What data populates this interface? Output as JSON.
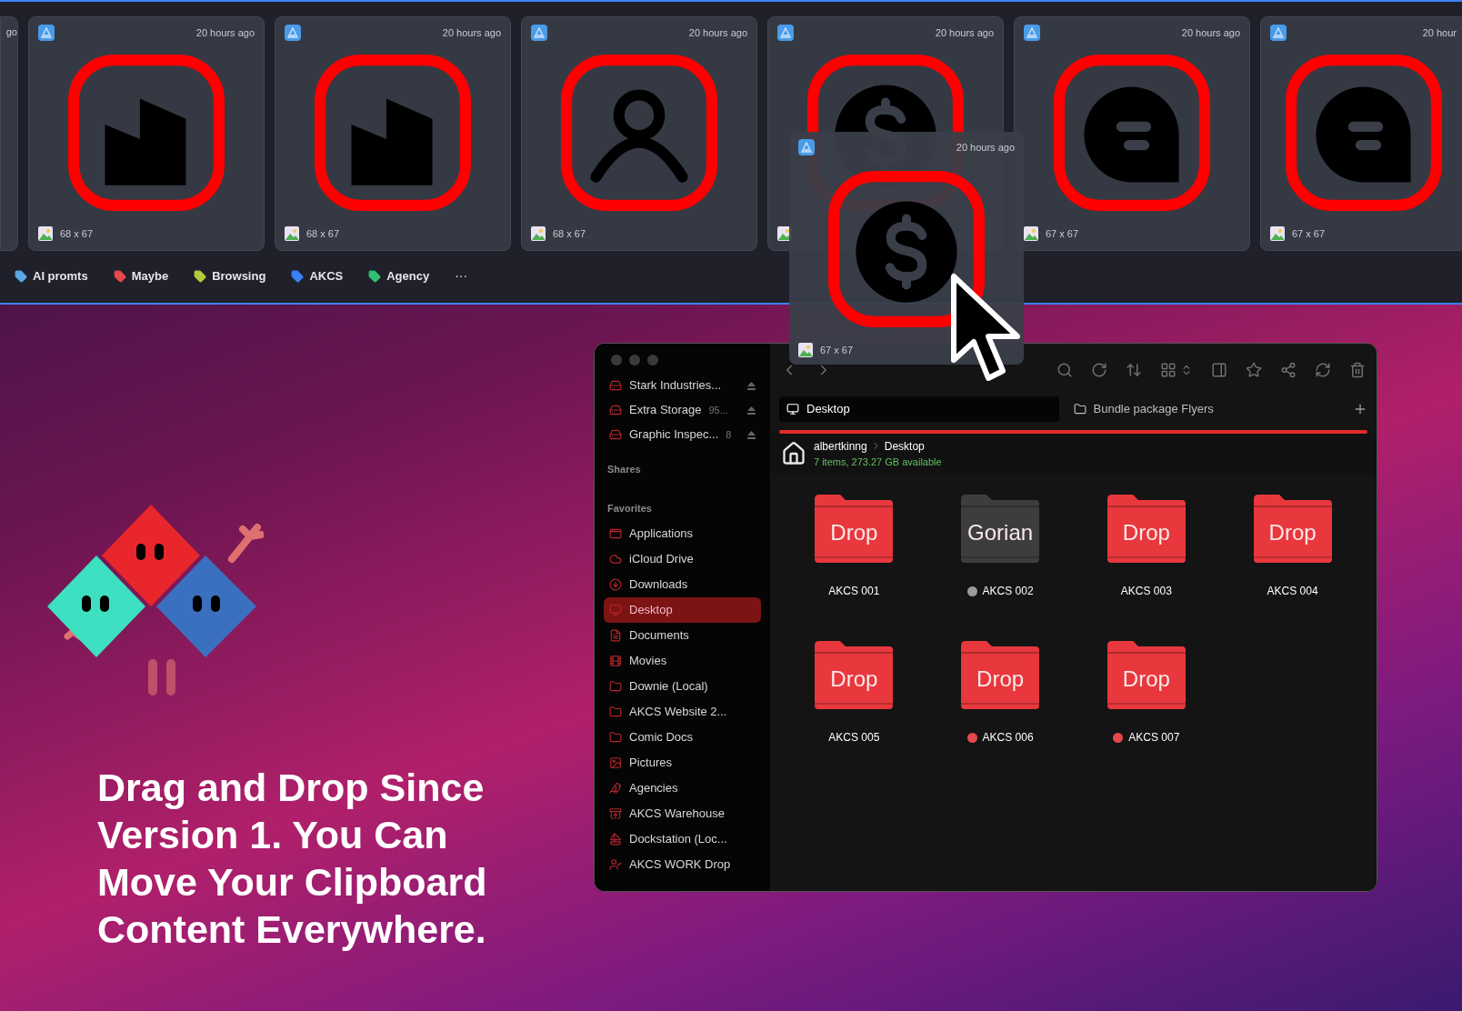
{
  "clipboard": {
    "partial_card": {
      "time": "go"
    },
    "cards": [
      {
        "time": "20 hours ago",
        "size": "68 x 67",
        "kind": "factory"
      },
      {
        "time": "20 hours ago",
        "size": "68 x 67",
        "kind": "factory"
      },
      {
        "time": "20 hours ago",
        "size": "68 x 67",
        "kind": "person"
      },
      {
        "time": "20 hours ago",
        "kind": "dollar"
      },
      {
        "time": "20 hours ago",
        "size": "67 x 67",
        "kind": "chat"
      },
      {
        "time": "20 hour",
        "size": "67 x 67",
        "kind": "chat"
      }
    ],
    "tags": [
      {
        "label": "AI promts",
        "color": "#5aa9e6"
      },
      {
        "label": "Maybe",
        "color": "#e5484d"
      },
      {
        "label": "Browsing",
        "color": "#b5c93a"
      },
      {
        "label": "AKCS",
        "color": "#3b82f6"
      },
      {
        "label": "Agency",
        "color": "#2fbf71"
      }
    ],
    "more": "···",
    "dragged_card": {
      "time": "20 hours ago",
      "size": "67 x 67",
      "kind": "dollar"
    }
  },
  "finder": {
    "devices": [
      {
        "name": "Stark Industries..."
      },
      {
        "name": "Extra Storage",
        "detail": "95..."
      },
      {
        "name": "Graphic Inspec...",
        "detail": "8"
      }
    ],
    "sections": [
      {
        "title": "Shares"
      },
      {
        "title": "Favorites",
        "items": [
          {
            "name": "Applications",
            "kind": "apps",
            "selected": false
          },
          {
            "name": "iCloud Drive",
            "kind": "cloud",
            "selected": false
          },
          {
            "name": "Downloads",
            "kind": "download",
            "selected": false
          },
          {
            "name": "Desktop",
            "kind": "desktop",
            "selected": true
          },
          {
            "name": "Documents",
            "kind": "doc",
            "selected": false
          },
          {
            "name": "Movies",
            "kind": "film",
            "selected": false
          },
          {
            "name": "Downie (Local)",
            "kind": "folder",
            "selected": false
          },
          {
            "name": "AKCS Website 2...",
            "kind": "folder",
            "selected": false
          },
          {
            "name": "Comic Docs",
            "kind": "folder",
            "selected": false
          },
          {
            "name": "Pictures",
            "kind": "image",
            "selected": false
          },
          {
            "name": "Agencies",
            "kind": "agent",
            "selected": false
          },
          {
            "name": "AKCS Warehouse",
            "kind": "box",
            "selected": false
          },
          {
            "name": "Dockstation (Loc...",
            "kind": "boat",
            "selected": false
          },
          {
            "name": "AKCS WORK Drop",
            "kind": "user",
            "selected": false
          }
        ]
      }
    ],
    "tabs": [
      {
        "label": "Desktop",
        "selected": true
      },
      {
        "label": "Bundle package Flyers",
        "selected": false
      }
    ],
    "path": [
      "albertkinng",
      "Desktop"
    ],
    "status": "7 items, 273.27 GB available",
    "files": [
      {
        "name": "AKCS 001",
        "folder_label": "Drop",
        "kind": "red"
      },
      {
        "name": "AKCS 002",
        "folder_label": "Gorian",
        "kind": "dark",
        "color": "#9a9a9a"
      },
      {
        "name": "AKCS 003",
        "folder_label": "Drop",
        "kind": "red"
      },
      {
        "name": "AKCS 004",
        "folder_label": "Drop",
        "kind": "red"
      },
      {
        "name": "AKCS 005",
        "folder_label": "Drop",
        "kind": "red"
      },
      {
        "name": "AKCS 006",
        "folder_label": "Drop",
        "kind": "red",
        "color": "#e5484d"
      },
      {
        "name": "AKCS 007",
        "folder_label": "Drop",
        "kind": "red",
        "color": "#e5484d"
      }
    ]
  },
  "headline": "Drag and Drop Since Version 1. You Can Move Your Clipboard Content Everywhere."
}
